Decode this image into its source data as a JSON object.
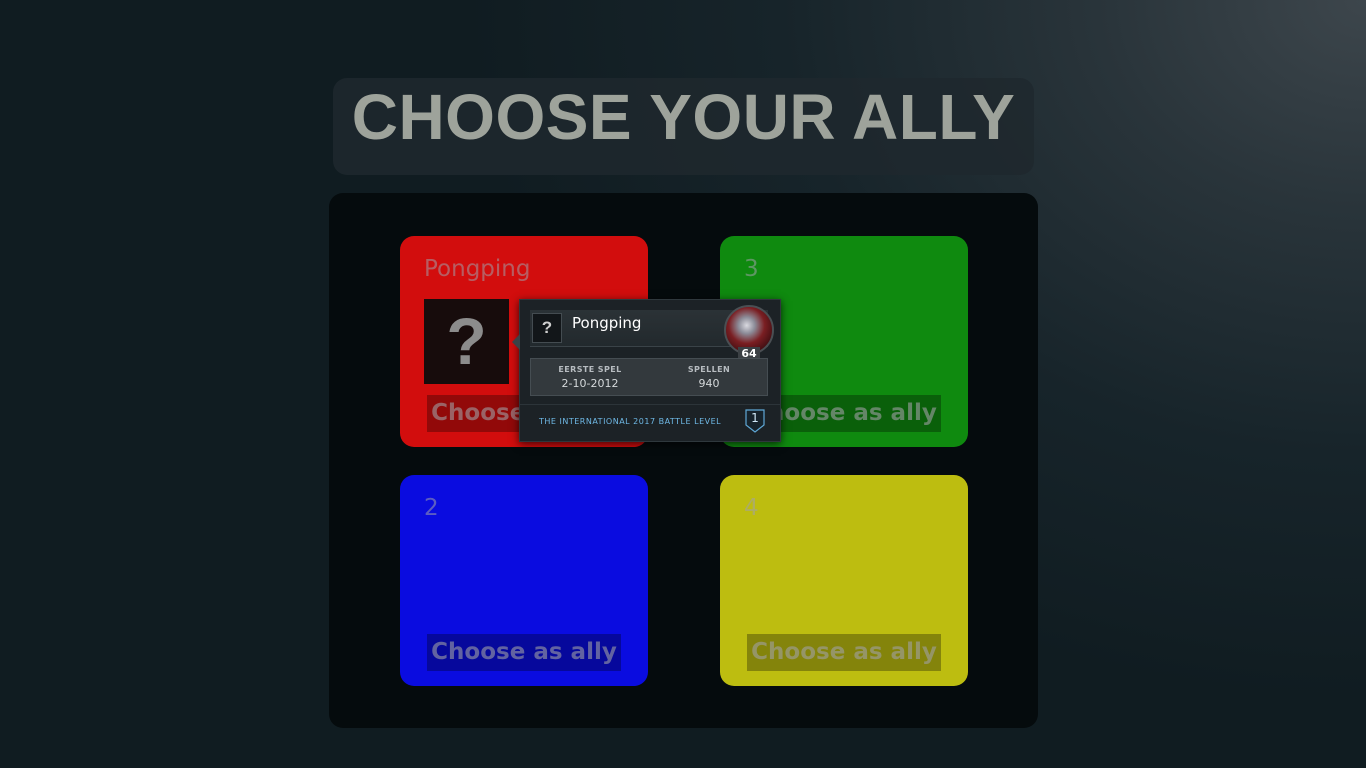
{
  "title": "CHOOSE YOUR ALLY",
  "slots": [
    {
      "name": "Pongping",
      "button": "Choose as ally",
      "color": "#d20d0d",
      "avatar_glyph": "?"
    },
    {
      "name": "3",
      "button": "Choose as ally",
      "color": "#0f8a0f"
    },
    {
      "name": "2",
      "button": "Choose as ally",
      "color": "#0a0ce0"
    },
    {
      "name": "4",
      "button": "Choose as ally",
      "color": "#bdbd10"
    }
  ],
  "tooltip": {
    "badge_glyph": "?",
    "player_name": "Pongping",
    "level": "64",
    "first_game_label": "EERSTE SPEL",
    "first_game_value": "2-10-2012",
    "games_label": "SPELLEN",
    "games_value": "940",
    "battle_level_label": "THE INTERNATIONAL 2017 BATTLE LEVEL",
    "battle_level_value": "1",
    "accent_color": "#6fb9e6"
  }
}
